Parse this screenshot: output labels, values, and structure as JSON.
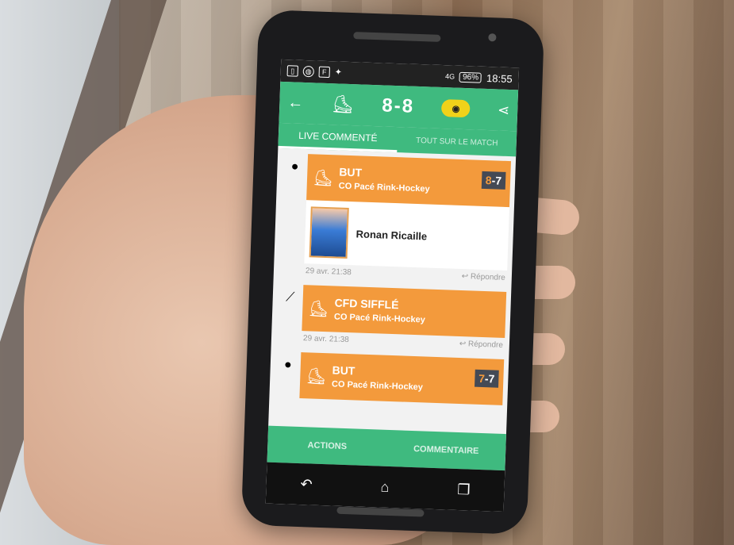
{
  "statusbar": {
    "icons": [
      "sim-icon",
      "whatsapp-icon",
      "flipboard-icon",
      "twitter-icon"
    ],
    "signal": "4G",
    "battery": "96%",
    "time": "18:55"
  },
  "header": {
    "score": "8-8"
  },
  "tabs": [
    {
      "label": "LIVE COMMENTÉ"
    },
    {
      "label": "TOUT SUR LE MATCH"
    }
  ],
  "events": [
    {
      "icon": "puck-icon",
      "title": "BUT",
      "team": "CO Pacé Rink-Hockey",
      "score_a": "8",
      "score_sep": "-",
      "score_b": "7",
      "player": "Ronan Ricaille",
      "time": "29 avr. 21:38",
      "reply": "Répondre"
    },
    {
      "icon": "stick-icon",
      "title": "CFD SIFFLÉ",
      "team": "CO Pacé Rink-Hockey",
      "time": "29 avr. 21:38",
      "reply": "Répondre"
    },
    {
      "icon": "puck-icon",
      "title": "BUT",
      "team": "CO Pacé Rink-Hockey",
      "score_a": "7",
      "score_sep": "-",
      "score_b": "7"
    }
  ],
  "bottom_tabs": [
    {
      "label": "ACTIONS"
    },
    {
      "label": "COMMENTAIRE"
    }
  ],
  "colors": {
    "green": "#3fba7f",
    "orange": "#f39a3c",
    "score_bg": "#444a55"
  }
}
